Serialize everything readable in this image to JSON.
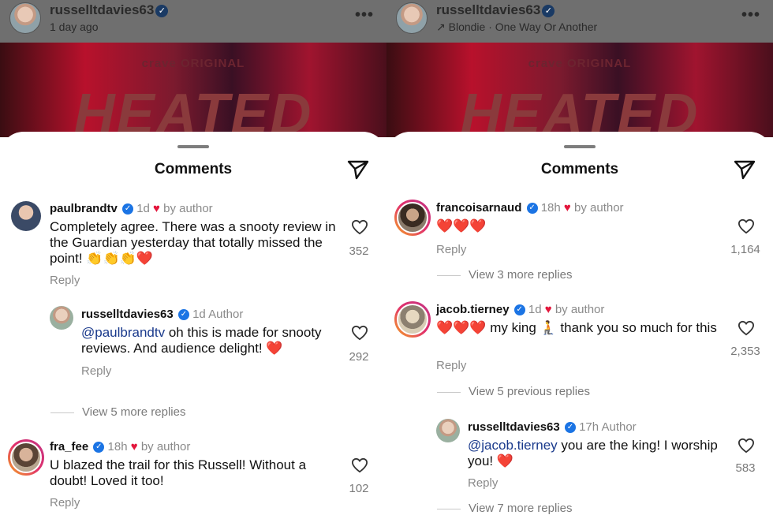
{
  "left": {
    "post": {
      "username": "russelltdavies63",
      "subtitle": "1 day ago"
    },
    "hero": {
      "brand": "crave ORIGINAL",
      "title": "HEATED"
    },
    "sheet": {
      "title": "Comments"
    },
    "comments": [
      {
        "username": "paulbrandtv",
        "time": "1d",
        "badge": "by author",
        "text": "Completely agree. There was a snooty review in the Guardian yesterday that totally missed the point! 👏👏👏❤️",
        "reply": "Reply",
        "likes": "352"
      },
      {
        "username": "russelltdavies63",
        "time": "1d",
        "badge": "Author",
        "mention": "@paulbrandtv",
        "text": " oh this is made for snooty reviews. And audience delight! ❤️",
        "reply": "Reply",
        "likes": "292"
      },
      {
        "username": "fra_fee",
        "time": "18h",
        "badge": "by author",
        "text": "U blazed the trail for this Russell! Without a doubt! Loved it too!",
        "reply": "Reply",
        "likes": "102"
      }
    ],
    "view_more": "View 5 more replies"
  },
  "right": {
    "post": {
      "username": "russelltdavies63",
      "subtitle": "Blondie · One Way Or Another"
    },
    "hero": {
      "brand": "crave ORIGINAL",
      "title": "HEATED"
    },
    "sheet": {
      "title": "Comments"
    },
    "comments": [
      {
        "username": "francoisarnaud",
        "time": "18h",
        "badge": "by author",
        "text": "❤️❤️❤️",
        "reply": "Reply",
        "likes": "1,164"
      },
      {
        "username": "jacob.tierney",
        "time": "1d",
        "badge": "by author",
        "text": "❤️❤️❤️ my king 🧎 thank you so much for this",
        "reply": "Reply",
        "likes": "2,353"
      },
      {
        "username": "russelltdavies63",
        "time": "17h",
        "badge": "Author",
        "mention": "@jacob.tierney",
        "text": " you are the king! I worship you! ❤️",
        "reply": "Reply",
        "likes": "583"
      }
    ],
    "view_more_1": "View 3 more replies",
    "view_prev": "View 5 previous replies",
    "view_more_2": "View 7 more replies"
  },
  "icons": {
    "verified": "verified-badge-icon",
    "heart": "heart-outline-icon",
    "share": "paper-plane-icon",
    "more": "more-dots-icon",
    "music": "arrow-icon"
  },
  "colors": {
    "heart_red": "#e3163c",
    "verified_blue": "#1b74e4",
    "mention": "#1a3a8c"
  }
}
